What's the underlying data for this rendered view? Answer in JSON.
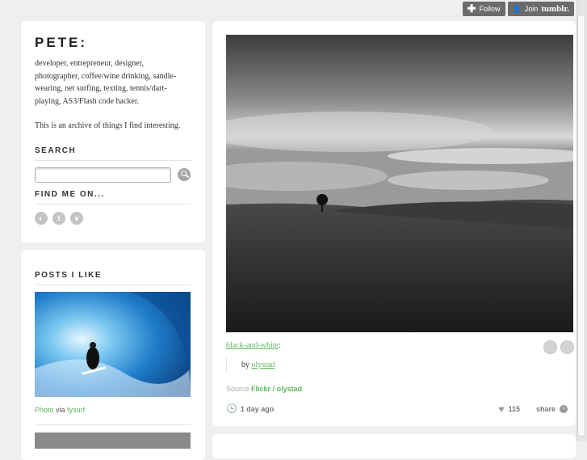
{
  "topbar": {
    "follow_label": "Follow",
    "join_label": "Join",
    "join_brand": "tumblr."
  },
  "about": {
    "title": "PETE:",
    "description": "developer, entrepreneur, designer, photographer, coffee/wine drinking, sandle-wearing, net surfing, texting, tennis/dart-playing, AS3/Flash code hacker.",
    "archive_note": "This is an archive of things I find interesting.",
    "search_heading": "SEARCH",
    "find_heading": "FIND ME ON...",
    "social": [
      {
        "icon": "checker-icon",
        "glyph": "◐"
      },
      {
        "icon": "twitter-icon",
        "glyph": "t"
      },
      {
        "icon": "vimeo-icon",
        "glyph": "v"
      }
    ]
  },
  "likes": {
    "heading": "POSTS I LIKE",
    "caption_type": "Photo",
    "caption_via": "via",
    "caption_source": "fysurf"
  },
  "post": {
    "link_text": "black-and-white",
    "link_suffix": ":",
    "by_prefix": "by",
    "by_user": "olystad",
    "source_label": "Source",
    "source_site": "Flickr",
    "source_sep": "/",
    "source_user": "olystad",
    "time_ago": "1 day ago",
    "notes": "115",
    "share_label": "share"
  },
  "colors": {
    "accent": "#5cb85c",
    "background": "#efefef",
    "card": "#ffffff"
  }
}
